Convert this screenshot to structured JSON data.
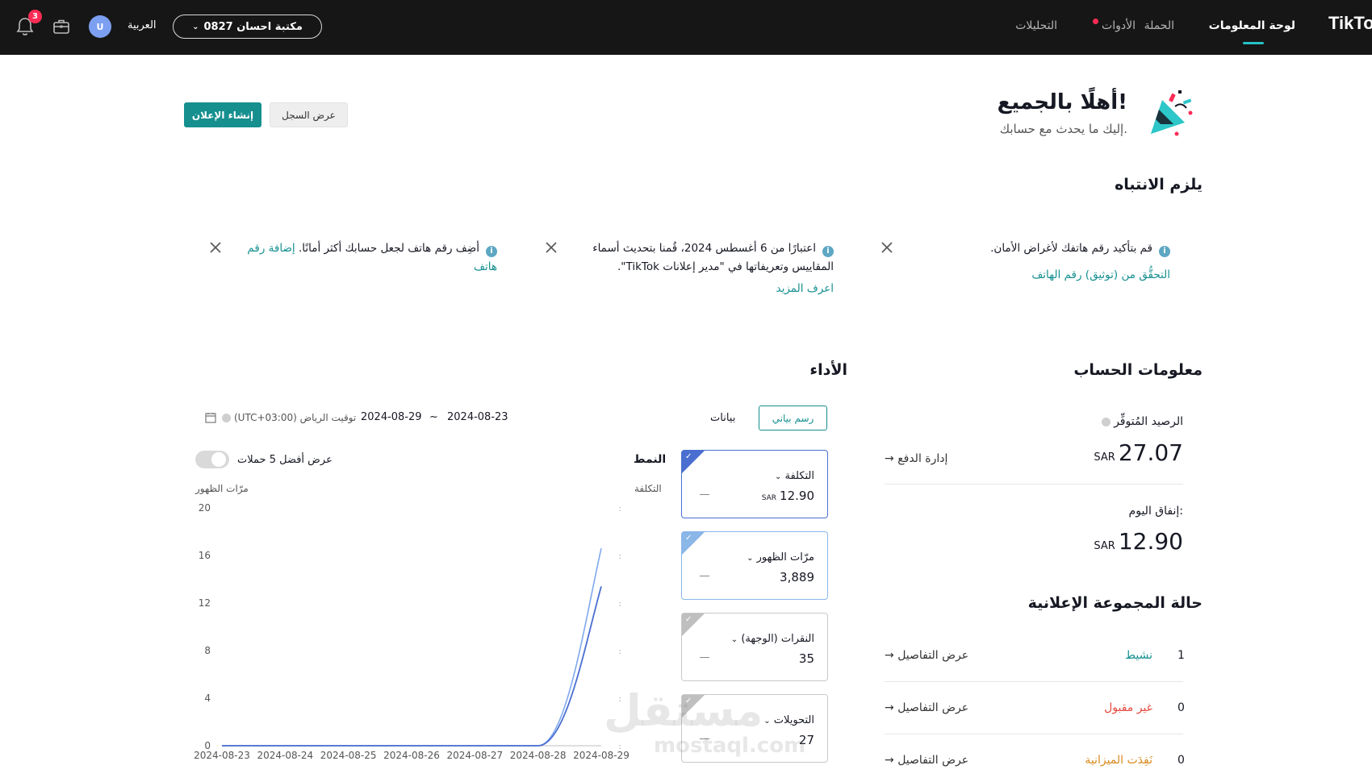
{
  "topbar": {
    "brand": "TikTok",
    "nav": {
      "dashboard": "لوحة المعلومات",
      "campaign": "الحملة",
      "tools": "الأدوات",
      "analytics": "التحليلات"
    },
    "account_select": "مكتبة احسان 0827",
    "language": "العربية",
    "avatar_initial": "U",
    "notification_count": "3",
    "colors": {
      "accent": "#25c2c6",
      "badge": "#fe2c55"
    }
  },
  "welcome": {
    "title": "أهلًا بالجميع!",
    "subtitle": "إليك ما يحدث مع حسابك.",
    "history_button": "عرض السجل",
    "create_button": "إنشاء الإعلان"
  },
  "attention": {
    "title": "يلزم الانتباه",
    "notices": [
      {
        "text": "قم بتأكيد رقم هاتفك لأغراض الأمان.",
        "link": "التحقُّق من (توثيق) رقم الهاتف"
      },
      {
        "text": "اعتبارًا من 6 أغسطس 2024، قُمنا بتحديث أسماء المقاييس وتعريفاتها في \"مدير إعلانات TikTok\".",
        "link": "اعرف المزيد"
      },
      {
        "text": "أضِف رقم هاتف لجعل حسابك أكثر أمانًا.",
        "link": "إضافة رقم هاتف"
      }
    ]
  },
  "account_info": {
    "title": "معلومات الحساب",
    "balance_label": "الرصيد المُتوفِّر",
    "balance_value": "27.07",
    "currency": "SAR",
    "manage_payment": "إدارة الدفع",
    "today_spend_label": "إنفاق اليوم:",
    "today_spend_value": "12.90"
  },
  "adgroup_status": {
    "title": "حالة المجموعة الإعلانية",
    "view_details": "عرض التفاصيل",
    "rows": [
      {
        "name": "نشيط",
        "count": "1",
        "color": "#168f8f"
      },
      {
        "name": "غير مقبول",
        "count": "0",
        "color": "#e5483d"
      },
      {
        "name": "نَفِدَت الميزانية",
        "count": "0",
        "color": "#d98a1e"
      }
    ]
  },
  "performance": {
    "title": "الأداء",
    "tab_chart": "رسم بياني",
    "tab_data": "بيانات",
    "date_start": "2024-08-23",
    "date_sep": "~",
    "date_end": "2024-08-29",
    "timezone": "(UTC+03:00) توقيت الرياض",
    "top5_label": "عرض أفضل 5 حملات",
    "mode_label": "النمط",
    "metrics": [
      {
        "name": "التكلفة",
        "value": "12.90",
        "currency": "SAR"
      },
      {
        "name": "مرّات الظهور",
        "value": "3,889"
      },
      {
        "name": "النقرات (الوجهة)",
        "value": "35"
      },
      {
        "name": "التحويلات",
        "value": "27"
      }
    ]
  },
  "chart_data": {
    "type": "line",
    "x": [
      "2024-08-23",
      "2024-08-24",
      "2024-08-25",
      "2024-08-26",
      "2024-08-27",
      "2024-08-28",
      "2024-08-29"
    ],
    "ylabel_left": "مرّات الظهور",
    "ylabel_right": "التكلفة",
    "ylim_left": [
      0,
      20
    ],
    "yticks_left": [
      "0",
      "4",
      "8",
      "12",
      "16",
      "20"
    ],
    "series": [
      {
        "name": "مرّات الظهور",
        "values": [
          0,
          0,
          0,
          0,
          0,
          0,
          16.6
        ],
        "color": "#7fa8ee"
      },
      {
        "name": "التكلفة",
        "values": [
          0,
          0,
          0,
          0,
          0,
          0,
          13.4
        ],
        "color": "#4a6fd1"
      }
    ],
    "grid": false
  },
  "watermark": {
    "text": "مستقل",
    "sub": "mostaql.com"
  }
}
